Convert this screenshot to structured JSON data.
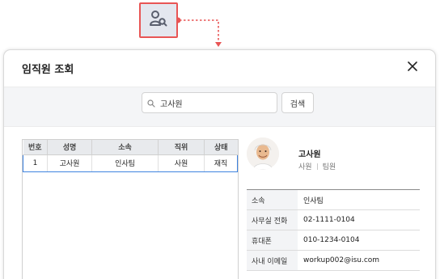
{
  "icons": {
    "trigger": "person-search-icon",
    "search": "search-icon",
    "close": "close-icon"
  },
  "colors": {
    "highlight_border": "#e85555",
    "connector": "#e85555",
    "selected_row": "#3f84e0",
    "header_bg": "#e8eaed"
  },
  "dialog": {
    "title": "임직원 조회"
  },
  "search": {
    "value": "고사원",
    "placeholder": "",
    "button_label": "검색"
  },
  "table": {
    "headers": [
      "번호",
      "성명",
      "소속",
      "직위",
      "상태"
    ],
    "rows": [
      [
        "1",
        "고사원",
        "인사팀",
        "사원",
        "재직"
      ]
    ]
  },
  "profile": {
    "name": "고사원",
    "position": "사원",
    "team": "팀원",
    "fields": [
      {
        "label": "소속",
        "value": "인사팀"
      },
      {
        "label": "사무실 전화",
        "value": "02-1111-0104"
      },
      {
        "label": "휴대폰",
        "value": "010-1234-0104"
      },
      {
        "label": "사내 이메일",
        "value": "workup002@isu.com"
      }
    ]
  }
}
